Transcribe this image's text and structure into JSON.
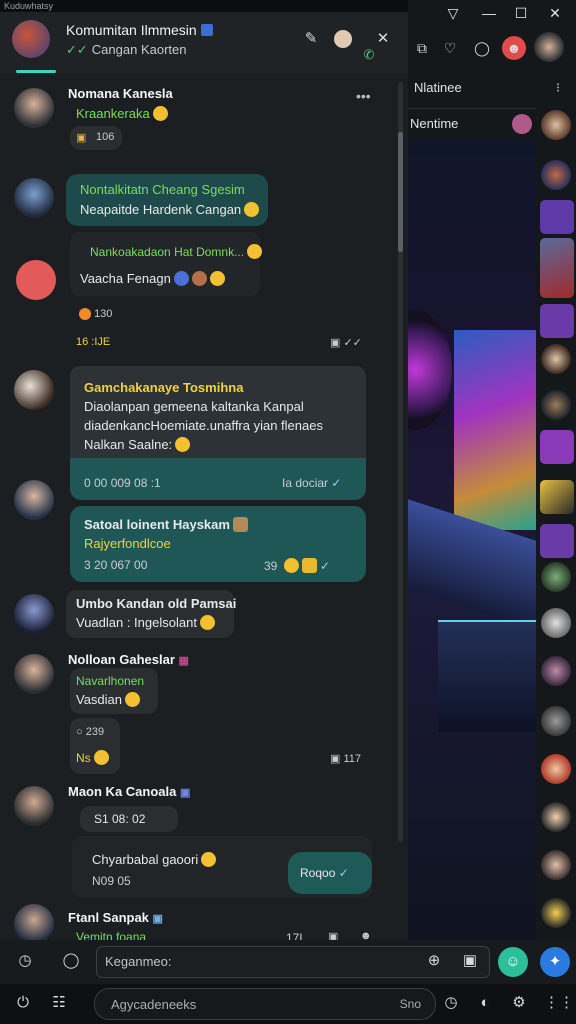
{
  "os": {
    "topbar_text": "Kuduwhatsy"
  },
  "header": {
    "title": "Komumitan Ilmmesin",
    "subtitle": "Cangan Kaorten",
    "icons": [
      "edit-icon",
      "avatar-small",
      "close-icon",
      "call-icon"
    ]
  },
  "messages": {
    "m1": {
      "name": "Nomana Kanesla",
      "sub": "Kraankeraka",
      "reaction": "106",
      "more": "•••"
    },
    "m2": {
      "line1": "Nontalkitatn Cheang Sgesim",
      "line2": "Neapaitde Hardenk Cangan"
    },
    "m3": {
      "line1": "Nankoakadaon Hat Domnk...",
      "line2": "Vaacha Fenagn",
      "react1": "130",
      "time": "16 :IJE"
    },
    "m4": {
      "title": "Gamchakanaye Tosmihna",
      "line1": "Diaolanpan gemeena kaltanka Kanpal",
      "line2": "diadenkancHoemiate.unaffra yian flenaes",
      "line3": "Nalkan Saalne:",
      "time": "0 00 009 08 :1",
      "status": "Ia dociar"
    },
    "m5": {
      "title": "Satoal loinent Hayskam",
      "sub": "Rajyerfondlcoe",
      "time": "3 20 067 00",
      "count": "39"
    },
    "m6": {
      "name": "Umbo Kandan old Pamsai",
      "line": "Vuadlan : Ingelsolant"
    },
    "m7": {
      "name": "Nolloan Gaheslar",
      "sub": "Navarlhonen",
      "line": "Vasdian",
      "react": "239",
      "react2": "Ns",
      "reply": "117"
    },
    "m8": {
      "name": "Maon Ka Canoala",
      "date": "S1 08: 02",
      "line": "Chyarbabal gaoori",
      "time": "N09 05",
      "btn": "Roqoo"
    },
    "m9": {
      "name": "Ftanl Sanpak",
      "sub": "Vemitn foana",
      "count": "17L"
    }
  },
  "right_panel": {
    "title": "Nlatinee",
    "subtitle": "Nentime"
  },
  "composer": {
    "placeholder": "Keganmeo:"
  },
  "taskbar": {
    "search_placeholder": "Agycadeneeks",
    "search_right": "Sno"
  },
  "window_controls": {
    "filter": "▽",
    "min": "—",
    "max": "☐",
    "close": "✕"
  }
}
